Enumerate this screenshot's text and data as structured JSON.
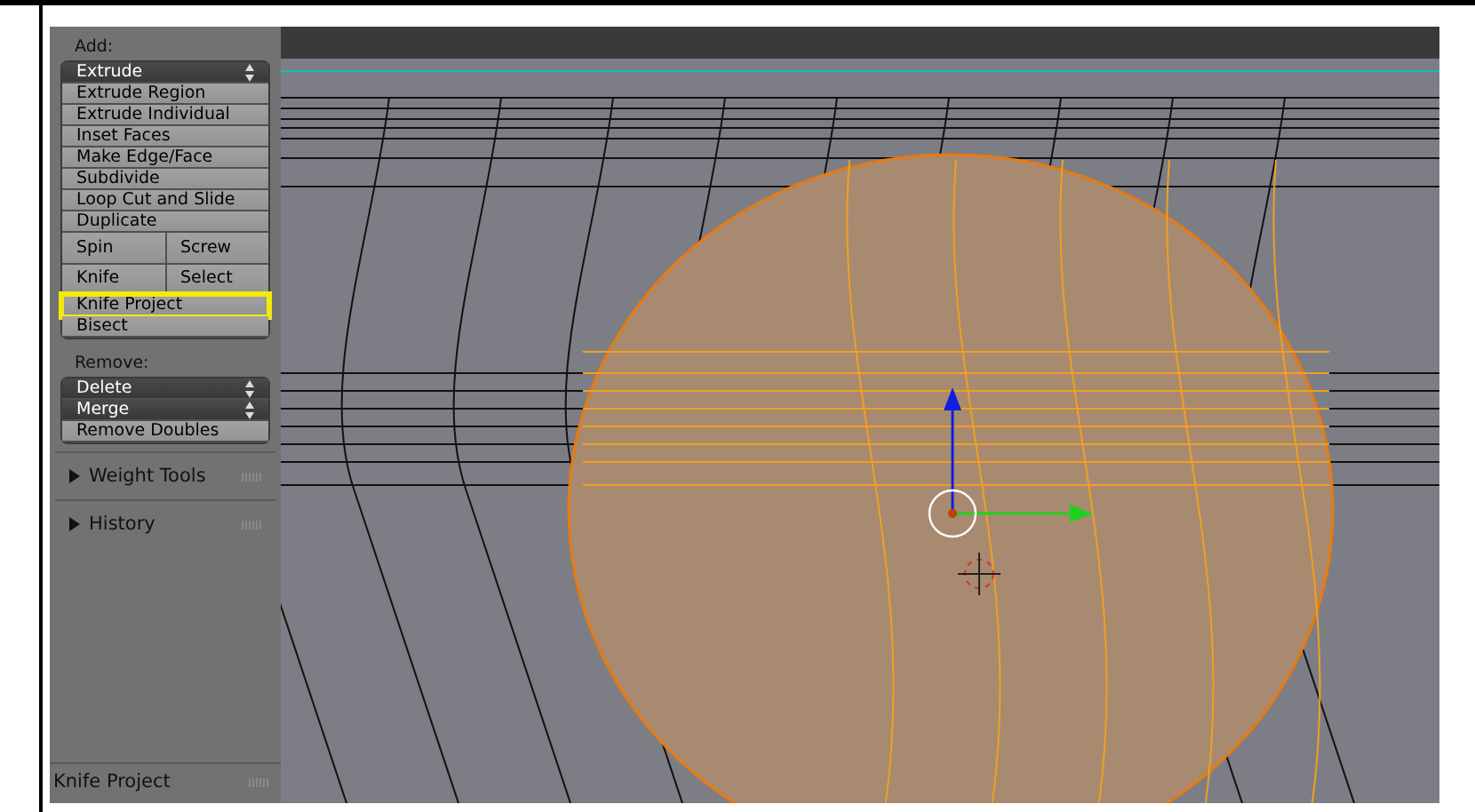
{
  "tool_shelf": {
    "add_label": "Add:",
    "add_items": [
      {
        "kind": "dropdown",
        "labels": [
          "Extrude"
        ],
        "highlighted": false
      },
      {
        "kind": "button",
        "labels": [
          "Extrude Region"
        ],
        "highlighted": false
      },
      {
        "kind": "button",
        "labels": [
          "Extrude Individual"
        ],
        "highlighted": false
      },
      {
        "kind": "button",
        "labels": [
          "Inset Faces"
        ],
        "highlighted": false
      },
      {
        "kind": "button",
        "labels": [
          "Make Edge/Face"
        ],
        "highlighted": false
      },
      {
        "kind": "button",
        "labels": [
          "Subdivide"
        ],
        "highlighted": false
      },
      {
        "kind": "button",
        "labels": [
          "Loop Cut and Slide"
        ],
        "highlighted": false
      },
      {
        "kind": "button",
        "labels": [
          "Duplicate"
        ],
        "highlighted": false
      },
      {
        "kind": "pair",
        "labels": [
          "Spin",
          "Screw"
        ],
        "highlighted": false
      },
      {
        "kind": "pair",
        "labels": [
          "Knife",
          "Select"
        ],
        "highlighted": false
      },
      {
        "kind": "button",
        "labels": [
          "Knife Project"
        ],
        "highlighted": true
      },
      {
        "kind": "button",
        "labels": [
          "Bisect"
        ],
        "highlighted": false
      }
    ],
    "remove_label": "Remove:",
    "remove_items": [
      {
        "kind": "dropdown",
        "labels": [
          "Delete"
        ],
        "highlighted": false
      },
      {
        "kind": "dropdown",
        "labels": [
          "Merge"
        ],
        "highlighted": false
      },
      {
        "kind": "button",
        "labels": [
          "Remove Doubles"
        ],
        "highlighted": false
      }
    ],
    "panels": [
      {
        "title": "Weight Tools",
        "expanded": false
      },
      {
        "title": "History",
        "expanded": false
      }
    ],
    "operator_panel": {
      "title": "Knife Project"
    }
  }
}
